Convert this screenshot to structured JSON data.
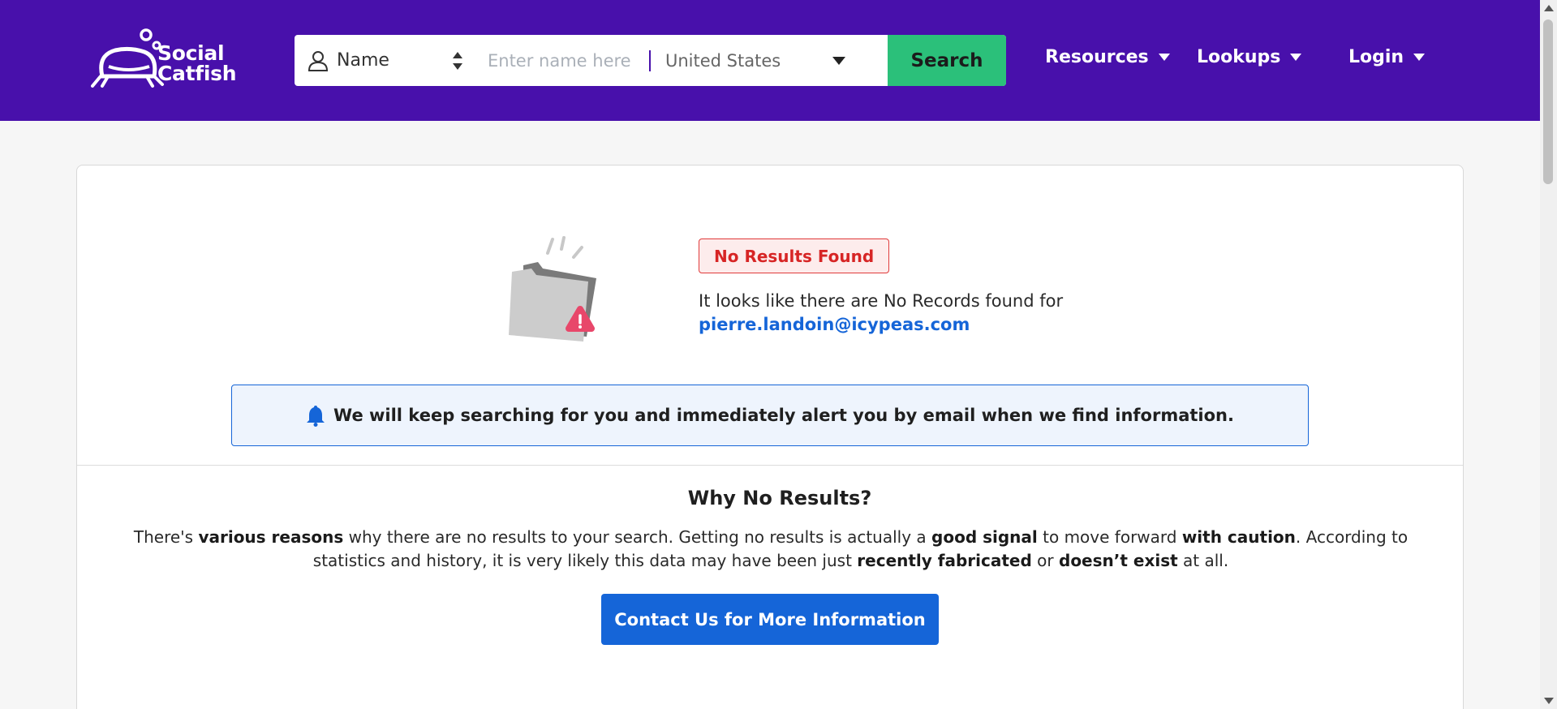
{
  "brand": {
    "line1": "Social",
    "line2": "Catfish"
  },
  "search": {
    "type_label": "Name",
    "name_value": "",
    "name_placeholder": "Enter name here",
    "country": "United States",
    "button_label": "Search"
  },
  "nav": {
    "resources": "Resources",
    "lookups": "Lookups",
    "login": "Login"
  },
  "result": {
    "badge": "No Results Found",
    "message": "It looks like there are No Records found for",
    "query": "pierre.landoin@icypeas.com"
  },
  "alert": {
    "text": "We will keep searching for you and immediately alert you by email when we find information."
  },
  "why": {
    "title": "Why No Results?",
    "parts": {
      "p1": "There's ",
      "b1": "various reasons",
      "p2": " why there are no results to your search. Getting no results is actually a ",
      "b2": "good signal",
      "p3": " to move forward ",
      "b3": "with caution",
      "p4": ". According to statistics and history, it is very likely this data may have been just ",
      "b4": "recently fabricated",
      "p5": " or ",
      "b5": "doesn’t exist",
      "p6": " at all."
    },
    "contact_label": "Contact Us for More Information"
  },
  "colors": {
    "header": "#4810ab",
    "search_button": "#2bc07a",
    "primary": "#1565d8",
    "error": "#d72525"
  },
  "icons": {
    "logo": "catfish-logo-icon",
    "person": "person-icon",
    "sort": "sort-arrows-icon",
    "dropdown": "caret-down-icon",
    "folder": "empty-folder-warning-icon",
    "bell": "bell-icon"
  }
}
